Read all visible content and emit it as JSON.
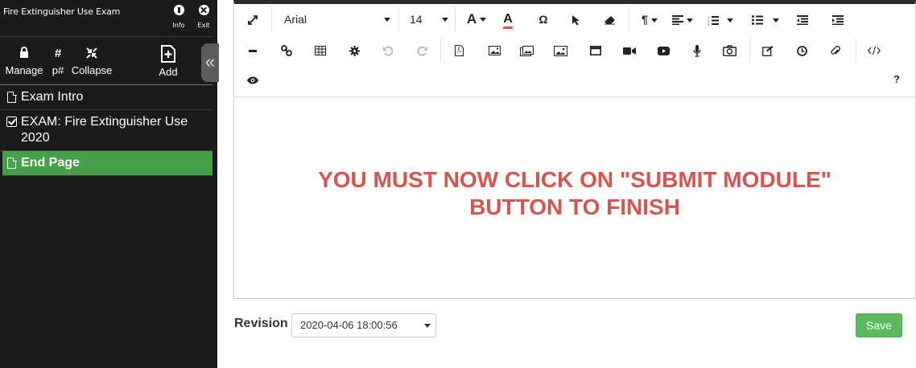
{
  "sidebar": {
    "title": "Fire Extinguisher Use Exam",
    "top_buttons": {
      "info": "Info",
      "exit": "Exit"
    },
    "tools": {
      "manage": "Manage",
      "page_number": "p#",
      "collapse": "Collapse",
      "add": "Add"
    },
    "pages": [
      {
        "label": "Exam Intro",
        "icon": "document-icon"
      },
      {
        "label": "EXAM: Fire Extinguisher Use 2020",
        "icon": "checkbox-icon"
      },
      {
        "label": "End Page",
        "icon": "document-icon",
        "active": true
      }
    ],
    "collapse_glyph": "«",
    "colors": {
      "background": "#1b1b1b",
      "active": "#46a049"
    }
  },
  "toolbar": {
    "font_family": "Arial",
    "font_size": "14",
    "help": "?",
    "special_char": "Ω",
    "paragraph": "¶"
  },
  "editor": {
    "content_line1": "YOU MUST NOW CLICK ON \"SUBMIT MODULE\"",
    "content_line2": "BUTTON TO FINISH",
    "content_color": "#d9534f"
  },
  "footer": {
    "revision_label": "Revision",
    "revision_value": "2020-04-06 18:00:56",
    "save_label": "Save",
    "save_color": "#5cb85c"
  }
}
